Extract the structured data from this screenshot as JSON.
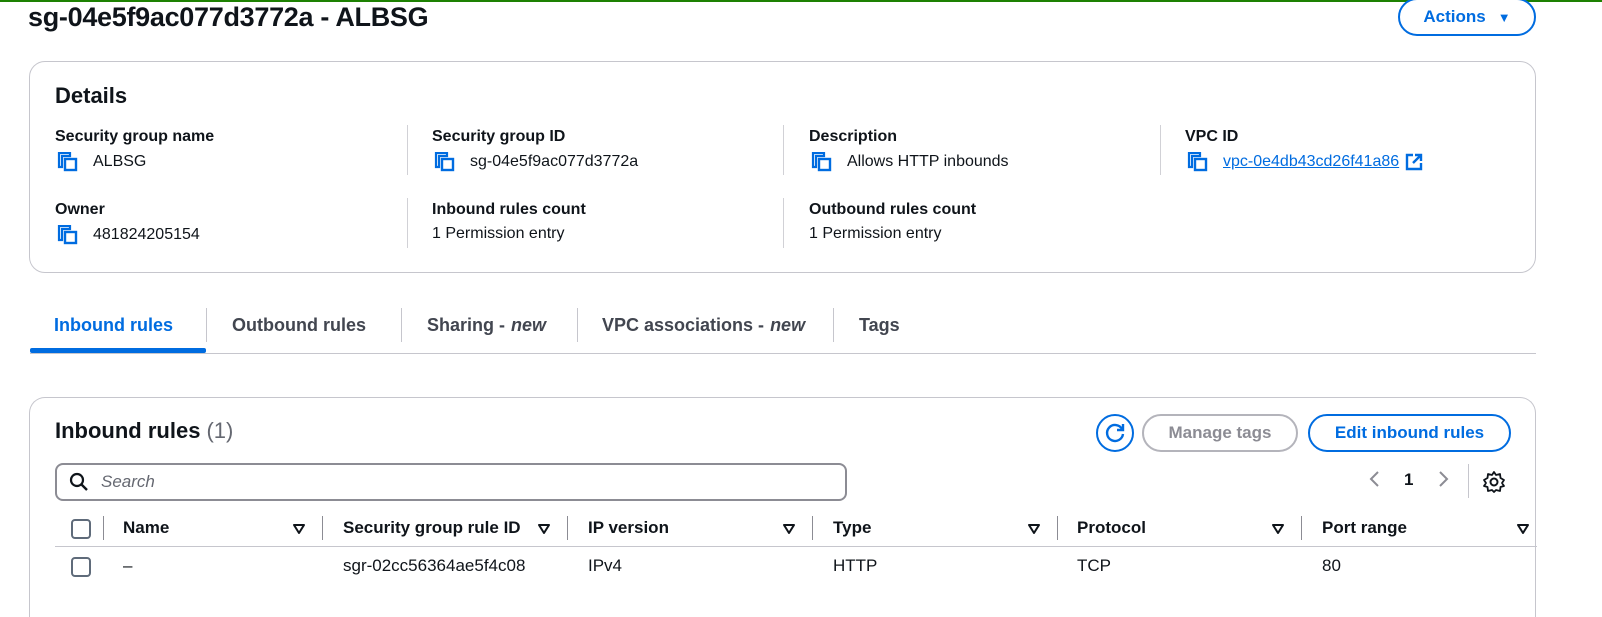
{
  "page": {
    "title": "sg-04e5f9ac077d3772a - ALBSG",
    "actions_label": "Actions"
  },
  "details": {
    "title": "Details",
    "sg_name_label": "Security group name",
    "sg_name": "ALBSG",
    "sg_id_label": "Security group ID",
    "sg_id": "sg-04e5f9ac077d3772a",
    "description_label": "Description",
    "description": "Allows HTTP inbounds",
    "vpc_id_label": "VPC ID",
    "vpc_id": "vpc-0e4db43cd26f41a86",
    "owner_label": "Owner",
    "owner": "481824205154",
    "inbound_count_label": "Inbound rules count",
    "inbound_count": "1 Permission entry",
    "outbound_count_label": "Outbound rules count",
    "outbound_count": "1 Permission entry"
  },
  "tabs": [
    {
      "label": "Inbound rules",
      "suffix": "",
      "active": true
    },
    {
      "label": "Outbound rules",
      "suffix": "",
      "active": false
    },
    {
      "label": "Sharing -",
      "suffix": "new",
      "active": false
    },
    {
      "label": "VPC associations -",
      "suffix": "new",
      "active": false
    },
    {
      "label": "Tags",
      "suffix": "",
      "active": false
    }
  ],
  "inbound": {
    "title": "Inbound rules",
    "count": "(1)",
    "manage_tags_label": "Manage tags",
    "edit_label": "Edit inbound rules",
    "search_placeholder": "Search",
    "page_number": "1",
    "columns": [
      "Name",
      "Security group rule ID",
      "IP version",
      "Type",
      "Protocol",
      "Port range"
    ],
    "rows": [
      {
        "name": "–",
        "rule_id": "sgr-02cc56364ae5f4c08",
        "ip_version": "IPv4",
        "type": "HTTP",
        "protocol": "TCP",
        "port_range": "80"
      }
    ]
  },
  "colors": {
    "accent": "#006ce0",
    "success_bar": "#1d8102",
    "border": "#c6c6cd"
  }
}
